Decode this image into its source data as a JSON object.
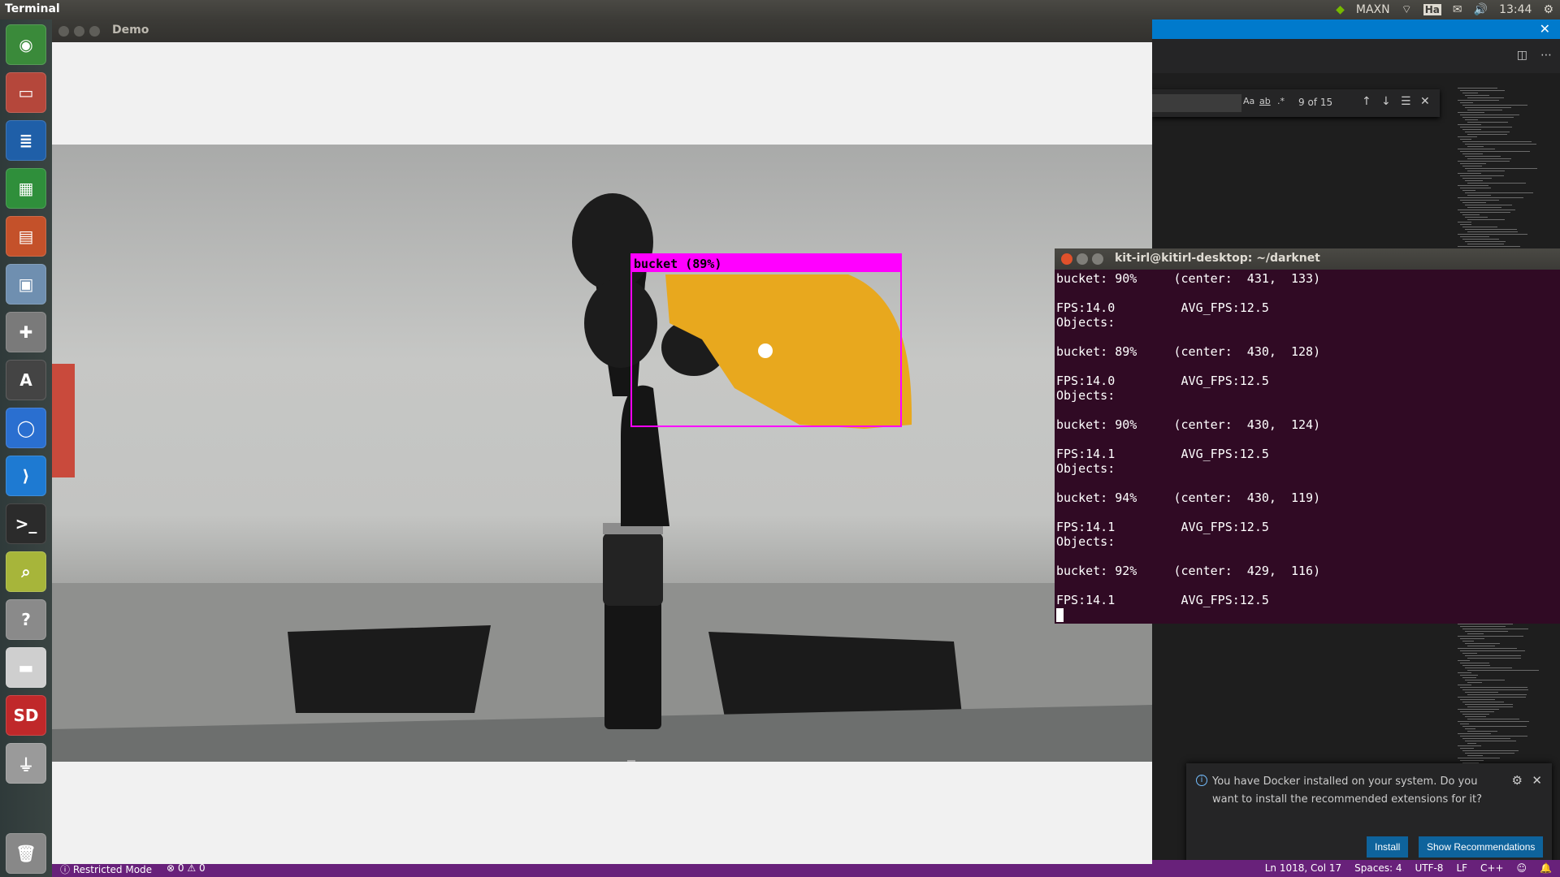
{
  "top_panel": {
    "title": "Terminal",
    "tray": {
      "power_mode": "MAXN",
      "keyboard": "Ha",
      "time": "13:44"
    },
    "icons": [
      "nvidia-icon",
      "wifi-icon",
      "keyboard-icon",
      "mail-icon",
      "volume-icon",
      "settings-icon"
    ]
  },
  "launcher": {
    "items": [
      {
        "name": "ubuntu-dash-icon",
        "color": "#3a8a3a",
        "glyph": "◉"
      },
      {
        "name": "files-icon",
        "color": "#b5473b",
        "glyph": "▭"
      },
      {
        "name": "writer-icon",
        "color": "#1f5fa8",
        "glyph": "≣"
      },
      {
        "name": "calc-icon",
        "color": "#2f8f3b",
        "glyph": "▦"
      },
      {
        "name": "impress-icon",
        "color": "#c4512a",
        "glyph": "▤"
      },
      {
        "name": "software-center-icon",
        "color": "#6f8fb0",
        "glyph": "▣"
      },
      {
        "name": "system-settings-icon",
        "color": "#7a7a7a",
        "glyph": "✚"
      },
      {
        "name": "software-updater-icon",
        "color": "#444444",
        "glyph": "A"
      },
      {
        "name": "chromium-icon",
        "color": "#2a6fd0",
        "glyph": "◯"
      },
      {
        "name": "vscode-icon",
        "color": "#1e7ad2",
        "glyph": "⟩"
      },
      {
        "name": "terminal-icon",
        "color": "#2b2b2b",
        "glyph": ">_"
      },
      {
        "name": "image-viewer-icon",
        "color": "#a7b53a",
        "glyph": "⌕"
      },
      {
        "name": "help-icon",
        "color": "#8a8a8a",
        "glyph": "?"
      },
      {
        "name": "drive-icon",
        "color": "#cfcfcf",
        "glyph": "▬"
      },
      {
        "name": "sd-card-icon",
        "color": "#c0282a",
        "glyph": "SD"
      },
      {
        "name": "usb-icon",
        "color": "#9a9a9a",
        "glyph": "⏚"
      },
      {
        "name": "trash-icon",
        "color": "#888888",
        "glyph": "🗑"
      }
    ]
  },
  "demo_window": {
    "title": "Demo",
    "detection": {
      "label": "bucket (89%)",
      "box_color": "#ff00ff"
    }
  },
  "terminal": {
    "title": "kit-irl@kitirl-desktop: ~/darknet",
    "lines": [
      "bucket: 90%     (center:  431,  133)",
      "",
      "FPS:14.0         AVG_FPS:12.5",
      "Objects:",
      "",
      "bucket: 89%     (center:  430,  128)",
      "",
      "FPS:14.0         AVG_FPS:12.5",
      "Objects:",
      "",
      "bucket: 90%     (center:  430,  124)",
      "",
      "FPS:14.1         AVG_FPS:12.5",
      "Objects:",
      "",
      "bucket: 94%     (center:  430,  119)",
      "",
      "FPS:14.1         AVG_FPS:12.5",
      "Objects:",
      "",
      "bucket: 92%     (center:  429,  116)",
      "",
      "FPS:14.1         AVG_FPS:12.5"
    ]
  },
  "vscode": {
    "find": {
      "count": "9 of 15",
      "case_label": "Aa",
      "word_label": "ab",
      "regex_label": ".*"
    },
    "notification": {
      "message": "You have Docker installed on your system. Do you want to install the recommended extensions for it?",
      "install": "Install",
      "show": "Show Recommendations"
    },
    "statusbar": {
      "restricted": "Restricted Mode",
      "problems": "⊗ 0 ⚠ 0",
      "position": "Ln 1018, Col 17",
      "spaces": "Spaces: 4",
      "encoding": "UTF-8",
      "eol": "LF",
      "language": "C++"
    }
  }
}
